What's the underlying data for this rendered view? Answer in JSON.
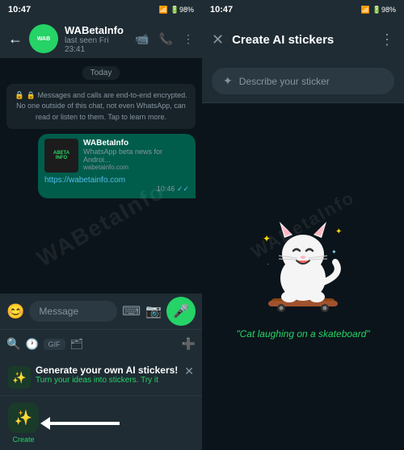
{
  "app": {
    "name": "WhatsApp"
  },
  "left": {
    "status_bar": {
      "time": "10:47",
      "icons": "🔇 ▾ 📶 📶 🔋98%"
    },
    "header": {
      "contact_name": "WABetaInfo",
      "contact_status": "last seen Fri 23:41",
      "avatar_text": "WAB"
    },
    "chat": {
      "date_label": "Today",
      "encrypted_notice": "🔒 Messages and calls are end-to-end encrypted. No one outside of this chat, not even WhatsApp, can read or listen to them. Tap to learn more.",
      "message": {
        "title": "WABetaInfo",
        "subtitle": "WhatsApp beta news for Androi...",
        "source": "wabetainfo.com",
        "link": "https://wabetainfo.com",
        "time": "10:46",
        "thumb_text": "ABETAINFO"
      }
    },
    "input": {
      "placeholder": "Message",
      "emoji_icon": "😊",
      "keyboard_icon": "⌨",
      "camera_icon": "📷"
    },
    "emoji_bar": {
      "search": "🔍",
      "recent": "🕐",
      "gif": "GIF",
      "sticker_icon": "🗂",
      "add": "➕"
    },
    "promo": {
      "title": "Generate your own AI stickers!",
      "subtitle": "Turn your ideas into stickers.",
      "cta": "Try it",
      "close": "✕",
      "icon": "✨"
    },
    "sticker_tray": {
      "create_label": "Create",
      "create_icon": "✨"
    }
  },
  "right": {
    "status_bar": {
      "time": "10:47",
      "icons": "🔇 ▾ 📶 📶 🔋98%"
    },
    "header": {
      "title": "Create AI stickers",
      "close_icon": "✕",
      "more_icon": "⋮"
    },
    "describe_input": {
      "placeholder": "Describe your sticker",
      "sparkle": "✦"
    },
    "sticker_preview": {
      "caption": "\"Cat laughing on a skateboard\""
    }
  },
  "watermark": "WABetaInfo"
}
